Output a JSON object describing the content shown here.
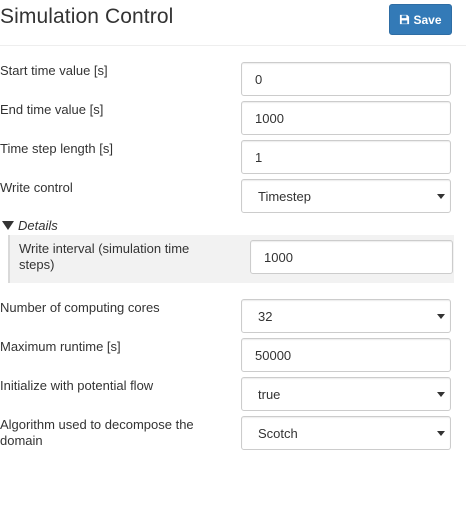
{
  "header": {
    "title": "Simulation Control",
    "save_label": "Save"
  },
  "fields": {
    "start_time": {
      "label": "Start time value [s]",
      "value": "0"
    },
    "end_time": {
      "label": "End time value [s]",
      "value": "1000"
    },
    "time_step": {
      "label": "Time step length [s]",
      "value": "1"
    },
    "write_control": {
      "label": "Write control",
      "value": "Timestep"
    },
    "details": {
      "summary": "Details",
      "write_interval": {
        "label": "Write interval (simulation time steps)",
        "value": "1000"
      }
    },
    "cores": {
      "label": "Number of computing cores",
      "value": "32"
    },
    "max_runtime": {
      "label": "Maximum runtime [s]",
      "value": "50000"
    },
    "potential_flow": {
      "label": "Initialize with potential flow",
      "value": "true"
    },
    "decompose": {
      "label": "Algorithm used to decompose the domain",
      "value": "Scotch"
    }
  },
  "colors": {
    "primary": "#337ab7",
    "details_bg": "#f2f2f2"
  }
}
